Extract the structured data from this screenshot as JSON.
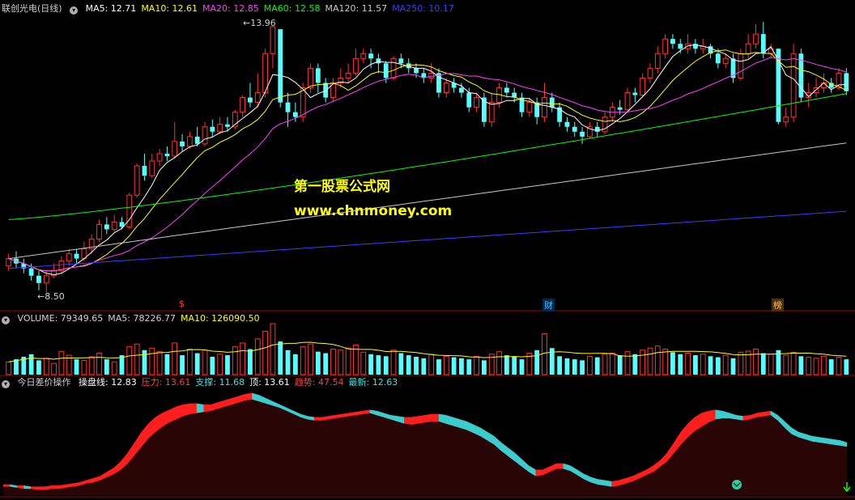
{
  "header": {
    "stock_name": "联创光电",
    "period": "(日线)",
    "ma": [
      {
        "label": "MA5: 12.71",
        "color": "#ffffff"
      },
      {
        "label": "MA10: 12.61",
        "color": "#ffff00"
      },
      {
        "label": "MA20: 12.85",
        "color": "#ff40ff"
      },
      {
        "label": "MA60: 12.58",
        "color": "#00ff00"
      },
      {
        "label": "MA120: 11.57",
        "color": "#c8c8c8"
      },
      {
        "label": "MA250: 10.17",
        "color": "#3c3cff"
      }
    ]
  },
  "volume_header": {
    "items": [
      {
        "label": "VOLUME: 79349.65",
        "color": "#d0d0d0"
      },
      {
        "label": "MA5: 78226.77",
        "color": "#d0d0d0"
      },
      {
        "label": "MA10: 126090.50",
        "color": "#ffff00"
      }
    ]
  },
  "indicator_header": {
    "name": "今日差价操作",
    "items": [
      {
        "label": "操盘线: 12.83",
        "color": "#ffffff"
      },
      {
        "label": "压力: 13.61",
        "color": "#ff4040"
      },
      {
        "label": "支撑: 11.68",
        "color": "#40e0e0"
      },
      {
        "label": "顶: 13.61",
        "color": "#ffffff"
      },
      {
        "label": "趋势: 47.54",
        "color": "#ff4040"
      },
      {
        "label": "最新: 12.63",
        "color": "#40e0e0"
      }
    ]
  },
  "watermark": {
    "line1": "第一股票公式网",
    "line2": "www.chnmoney.com"
  },
  "events": [
    {
      "label": "$",
      "color": "#ff4040"
    },
    {
      "label": "财",
      "color": "#40c0ff"
    },
    {
      "label": "榜",
      "color": "#ffc040"
    }
  ],
  "price_labels": {
    "high": "13.96",
    "low": "8.50"
  },
  "colors": {
    "up": "#ff3232",
    "down": "#54ffff",
    "separator": "#a00000",
    "ma5": "#ffffff",
    "ma10": "#ffff00",
    "ma20": "#ff40ff",
    "ma60": "#00ff00",
    "ma120": "#c8c8c8",
    "ma250": "#3c3cff"
  },
  "chart_data": [
    {
      "type": "candlestick",
      "title": "联创光电 (日线)",
      "ylim": [
        8.2,
        14.2
      ],
      "candles": [
        [
          9.05,
          9.2,
          9.3,
          8.95
        ],
        [
          9.2,
          9.1,
          9.35,
          9.0
        ],
        [
          9.1,
          9.0,
          9.2,
          8.9
        ],
        [
          9.0,
          8.85,
          9.1,
          8.75
        ],
        [
          8.85,
          8.7,
          8.95,
          8.55
        ],
        [
          8.7,
          8.85,
          8.95,
          8.5
        ],
        [
          8.85,
          8.95,
          9.1,
          8.8
        ],
        [
          8.95,
          9.15,
          9.25,
          8.9
        ],
        [
          9.15,
          9.3,
          9.4,
          9.05
        ],
        [
          9.3,
          9.2,
          9.4,
          9.1
        ],
        [
          9.2,
          9.4,
          9.55,
          9.15
        ],
        [
          9.4,
          9.6,
          9.7,
          9.3
        ],
        [
          9.6,
          9.9,
          10.0,
          9.55
        ],
        [
          9.9,
          9.8,
          10.05,
          9.7
        ],
        [
          9.8,
          9.95,
          10.1,
          9.75
        ],
        [
          9.95,
          9.85,
          10.05,
          9.8
        ],
        [
          9.85,
          10.5,
          10.55,
          9.8
        ],
        [
          10.5,
          11.1,
          11.15,
          10.45
        ],
        [
          11.1,
          10.9,
          11.35,
          10.8
        ],
        [
          10.9,
          11.2,
          11.35,
          10.85
        ],
        [
          11.2,
          11.35,
          11.45,
          11.1
        ],
        [
          11.35,
          11.3,
          11.5,
          11.2
        ],
        [
          11.3,
          11.6,
          12.0,
          11.25
        ],
        [
          11.6,
          11.5,
          11.75,
          11.4
        ],
        [
          11.5,
          11.7,
          11.8,
          11.45
        ],
        [
          11.7,
          11.55,
          11.9,
          11.5
        ],
        [
          11.55,
          11.9,
          12.0,
          11.5
        ],
        [
          11.9,
          11.8,
          12.05,
          11.7
        ],
        [
          11.8,
          11.95,
          12.1,
          11.75
        ],
        [
          11.95,
          11.9,
          12.1,
          11.8
        ],
        [
          11.9,
          12.2,
          12.25,
          11.85
        ],
        [
          12.2,
          12.5,
          12.55,
          12.1
        ],
        [
          12.5,
          12.4,
          12.8,
          12.3
        ],
        [
          12.4,
          12.6,
          13.0,
          12.3
        ],
        [
          12.6,
          13.4,
          13.5,
          12.5
        ],
        [
          13.4,
          13.95,
          13.96,
          13.1
        ],
        [
          13.9,
          12.4,
          13.85,
          12.3
        ],
        [
          12.4,
          12.2,
          12.6,
          11.9
        ],
        [
          12.2,
          12.1,
          12.4,
          12.0
        ],
        [
          12.1,
          12.7,
          12.8,
          12.0
        ],
        [
          12.7,
          13.1,
          13.2,
          12.6
        ],
        [
          13.1,
          12.8,
          13.2,
          12.6
        ],
        [
          12.8,
          12.5,
          12.9,
          12.4
        ],
        [
          12.5,
          12.8,
          12.9,
          12.4
        ],
        [
          12.8,
          12.9,
          13.1,
          12.7
        ],
        [
          12.9,
          13.0,
          13.2,
          12.8
        ],
        [
          13.0,
          13.3,
          13.5,
          12.95
        ],
        [
          13.3,
          13.4,
          13.5,
          13.2
        ],
        [
          13.4,
          13.3,
          13.5,
          13.1
        ],
        [
          13.3,
          13.2,
          13.4,
          13.0
        ],
        [
          13.2,
          12.9,
          13.25,
          12.8
        ],
        [
          12.9,
          13.3,
          13.35,
          12.85
        ],
        [
          13.3,
          13.2,
          13.4,
          13.1
        ],
        [
          13.2,
          13.1,
          13.3,
          13.0
        ],
        [
          13.1,
          13.0,
          13.2,
          12.9
        ],
        [
          13.0,
          12.9,
          13.1,
          12.8
        ],
        [
          12.9,
          13.0,
          13.2,
          12.8
        ],
        [
          13.0,
          12.6,
          13.1,
          12.5
        ],
        [
          12.6,
          12.8,
          12.9,
          12.5
        ],
        [
          12.8,
          12.7,
          12.9,
          12.6
        ],
        [
          12.7,
          12.6,
          12.8,
          12.5
        ],
        [
          12.6,
          12.3,
          12.7,
          12.2
        ],
        [
          12.3,
          12.5,
          12.6,
          12.2
        ],
        [
          12.5,
          12.0,
          12.6,
          11.9
        ],
        [
          12.0,
          12.4,
          12.6,
          11.9
        ],
        [
          12.4,
          12.7,
          12.8,
          12.3
        ],
        [
          12.7,
          12.6,
          12.8,
          12.5
        ],
        [
          12.6,
          12.5,
          12.7,
          12.4
        ],
        [
          12.5,
          12.2,
          12.6,
          12.1
        ],
        [
          12.2,
          12.4,
          12.5,
          12.1
        ],
        [
          12.4,
          12.1,
          12.5,
          11.95
        ],
        [
          12.1,
          12.5,
          12.8,
          12.0
        ],
        [
          12.5,
          12.3,
          12.6,
          12.2
        ],
        [
          12.3,
          12.0,
          12.4,
          11.9
        ],
        [
          12.0,
          11.9,
          12.1,
          11.8
        ],
        [
          11.9,
          11.8,
          12.0,
          11.7
        ],
        [
          11.8,
          11.7,
          11.9,
          11.55
        ],
        [
          11.7,
          11.9,
          12.0,
          11.65
        ],
        [
          11.9,
          11.8,
          12.0,
          11.7
        ],
        [
          11.8,
          12.1,
          12.2,
          11.75
        ],
        [
          12.1,
          12.3,
          12.4,
          12.0
        ],
        [
          12.3,
          12.25,
          12.45,
          12.15
        ],
        [
          12.25,
          12.6,
          12.7,
          12.2
        ],
        [
          12.6,
          12.55,
          12.7,
          12.4
        ],
        [
          12.55,
          12.9,
          13.0,
          12.5
        ],
        [
          12.9,
          13.1,
          13.2,
          12.8
        ],
        [
          13.1,
          13.4,
          13.55,
          13.0
        ],
        [
          13.4,
          13.7,
          13.8,
          13.3
        ],
        [
          13.7,
          13.6,
          13.8,
          13.5
        ],
        [
          13.6,
          13.5,
          13.7,
          13.4
        ],
        [
          13.5,
          13.6,
          13.8,
          13.4
        ],
        [
          13.6,
          13.5,
          13.7,
          13.4
        ],
        [
          13.5,
          13.55,
          13.7,
          13.4
        ],
        [
          13.55,
          13.4,
          13.6,
          13.3
        ],
        [
          13.4,
          13.2,
          13.5,
          13.1
        ],
        [
          13.2,
          13.3,
          13.4,
          13.1
        ],
        [
          13.3,
          12.9,
          13.4,
          12.8
        ],
        [
          12.9,
          13.4,
          13.5,
          12.85
        ],
        [
          13.4,
          13.6,
          13.8,
          13.3
        ],
        [
          13.6,
          13.8,
          14.0,
          13.5
        ],
        [
          13.8,
          13.4,
          14.05,
          13.3
        ],
        [
          13.4,
          13.5,
          13.6,
          13.3
        ],
        [
          13.5,
          12.0,
          13.5,
          11.95
        ],
        [
          12.0,
          12.1,
          12.3,
          11.9
        ],
        [
          12.1,
          13.4,
          13.6,
          12.0
        ],
        [
          13.4,
          12.5,
          13.5,
          12.4
        ],
        [
          12.5,
          12.6,
          12.8,
          12.3
        ],
        [
          12.6,
          12.7,
          12.9,
          12.5
        ],
        [
          12.7,
          12.8,
          13.0,
          12.6
        ],
        [
          12.8,
          12.7,
          12.9,
          12.6
        ],
        [
          12.7,
          13.0,
          13.1,
          12.65
        ],
        [
          13.0,
          12.63,
          13.1,
          12.55
        ]
      ],
      "ma_lines": [
        "MA5",
        "MA10",
        "MA20",
        "MA60",
        "MA120",
        "MA250"
      ]
    },
    {
      "type": "bar",
      "title": "VOLUME",
      "values": [
        25,
        30,
        35,
        40,
        28,
        32,
        22,
        45,
        38,
        30,
        28,
        35,
        42,
        30,
        25,
        38,
        55,
        60,
        48,
        52,
        45,
        40,
        62,
        38,
        50,
        42,
        48,
        35,
        40,
        38,
        55,
        62,
        50,
        70,
        85,
        100,
        65,
        48,
        40,
        55,
        60,
        45,
        42,
        50,
        48,
        52,
        58,
        44,
        40,
        38,
        36,
        48,
        42,
        38,
        35,
        32,
        40,
        30,
        36,
        34,
        32,
        30,
        36,
        28,
        40,
        45,
        38,
        36,
        30,
        42,
        48,
        80,
        52,
        36,
        32,
        30,
        28,
        36,
        34,
        40,
        42,
        38,
        45,
        40,
        48,
        52,
        56,
        50,
        44,
        40,
        42,
        38,
        40,
        36,
        34,
        38,
        32,
        44,
        46,
        50,
        42,
        40,
        48,
        38,
        44,
        36,
        34,
        32,
        36,
        30,
        34,
        30
      ],
      "ylim": [
        0,
        100
      ]
    },
    {
      "type": "area",
      "title": "今日差价操作",
      "values": [
        10,
        10,
        9,
        9,
        8,
        8,
        8,
        9,
        9,
        10,
        11,
        12,
        14,
        16,
        18,
        22,
        26,
        32,
        40,
        50,
        60,
        68,
        74,
        78,
        81,
        84,
        86,
        87,
        87,
        86,
        86,
        88,
        90,
        92,
        94,
        96,
        97,
        95,
        92,
        89,
        86,
        83,
        80,
        77,
        75,
        74,
        74,
        75,
        76,
        77,
        78,
        79,
        80,
        81,
        80,
        78,
        76,
        75,
        74,
        74,
        75,
        76,
        77,
        77,
        76,
        74,
        72,
        70,
        67,
        64,
        60,
        56,
        50,
        45,
        40,
        34,
        28,
        24,
        24,
        27,
        30,
        30,
        28,
        24,
        20,
        17,
        15,
        14,
        13,
        14,
        16,
        18,
        21,
        24,
        28,
        33,
        40,
        50,
        60,
        68,
        74,
        78,
        80,
        81,
        80,
        78,
        76,
        75,
        76,
        78,
        79,
        80,
        76,
        70,
        64,
        60,
        58,
        56,
        55,
        54,
        53,
        52,
        50
      ],
      "support": [
        10,
        10,
        9,
        8,
        8,
        7,
        7,
        8,
        8,
        9,
        10,
        11,
        13,
        14,
        16,
        19,
        22,
        26,
        32,
        40,
        48,
        56,
        62,
        67,
        71,
        74,
        77,
        79,
        80,
        81,
        82,
        84,
        86,
        88,
        90,
        92,
        93,
        91,
        89,
        87,
        85,
        82,
        79,
        76,
        74,
        73,
        73,
        74,
        75,
        76,
        77,
        78,
        79,
        80,
        78,
        76,
        74,
        72,
        70,
        69,
        70,
        71,
        72,
        72,
        70,
        68,
        66,
        64,
        61,
        58,
        54,
        50,
        44,
        39,
        34,
        29,
        24,
        20,
        21,
        24,
        27,
        27,
        25,
        21,
        17,
        14,
        12,
        11,
        10,
        11,
        13,
        15,
        18,
        21,
        24,
        29,
        34,
        42,
        50,
        57,
        63,
        67,
        71,
        74,
        75,
        75,
        74,
        73,
        74,
        76,
        77,
        78,
        73,
        66,
        60,
        57,
        55,
        53,
        52,
        51,
        50,
        49,
        48
      ],
      "ylim": [
        0,
        100
      ]
    }
  ]
}
